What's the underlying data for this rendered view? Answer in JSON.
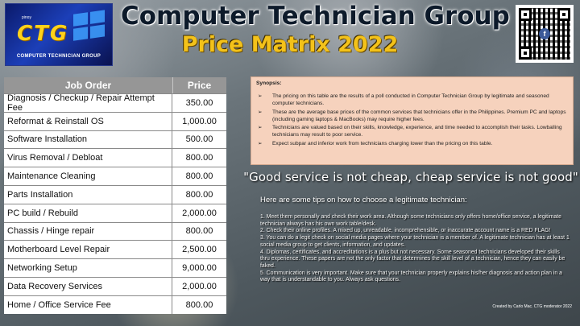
{
  "logo": {
    "text": "CTG",
    "tagline": "COMPUTER TECHNICIAN GROUP",
    "small": "pinoy"
  },
  "header": {
    "title": "Computer Technician Group",
    "subtitle": "Price Matrix 2022"
  },
  "qr": {
    "badge": "f"
  },
  "table": {
    "headers": {
      "job": "Job Order",
      "price": "Price"
    },
    "rows": [
      {
        "job": "Diagnosis / Checkup / Repair Attempt Fee",
        "price": "350.00"
      },
      {
        "job": "Reformat & Reinstall OS",
        "price": "1,000.00"
      },
      {
        "job": "Software Installation",
        "price": "500.00"
      },
      {
        "job": "Virus Removal / Debloat",
        "price": "800.00"
      },
      {
        "job": "Maintenance Cleaning",
        "price": "800.00"
      },
      {
        "job": "Parts Installation",
        "price": "800.00"
      },
      {
        "job": "PC build / Rebuild",
        "price": "2,000.00"
      },
      {
        "job": "Chassis / Hinge repair",
        "price": "800.00"
      },
      {
        "job": "Motherboard Level Repair",
        "price": "2,500.00"
      },
      {
        "job": "Networking Setup",
        "price": "9,000.00"
      },
      {
        "job": "Data Recovery Services",
        "price": "2,000.00"
      },
      {
        "job": "Home / Office  Service Fee",
        "price": "800.00"
      }
    ]
  },
  "synopsis": {
    "title": "Synopsis:",
    "bullet": "➢",
    "items": [
      "The pricing on this table are the results of a poll conducted in Computer Technician Group by legitimate and seasoned computer technicians.",
      "These are the average base prices of the common services that technicians offer in the Philippines. Premium PC and laptops (including gaming laptops & MacBooks) may require higher fees.",
      "Technicians are valued based on their skills, knowledge, experience, and time needed to accomplish their tasks. Lowballing technicians may result to poor service.",
      "Expect subpar and inferior work from technicians charging lower than the pricing on this table."
    ]
  },
  "quote": "\"Good service is not cheap, cheap service is not good\"",
  "tips": {
    "title": "Here are some tips on how to choose a legitimate technician:",
    "items": [
      "1. Meet them personally and check their work area. Although some technicians only offers home/office service, a legitimate technician always has his own work table/desk.",
      "2. Check their online profiles. A mixed up, unreadable, incomprehensible, or inaccurate account name is a RED FLAG!",
      "3. You can do a legit check on social media pages where your technician is a member of. A legitimate technician has at least 1 social media group to get clients, information, and updates.",
      "4. Diplomas, certificates, and accreditations is a plus but not necessary. Some seasoned technicians developed their skills thru experience. These papers are not the only factor that determines the skill level of a technician, hence they can easily be faked.",
      "5. Communication is very important. Make sure that your technician properly explains his/her diagnosis and action plan in a way that is understandable to you. Always ask questions."
    ]
  },
  "credit": "Created by Carlo Mac. CTG moderator 2022"
}
